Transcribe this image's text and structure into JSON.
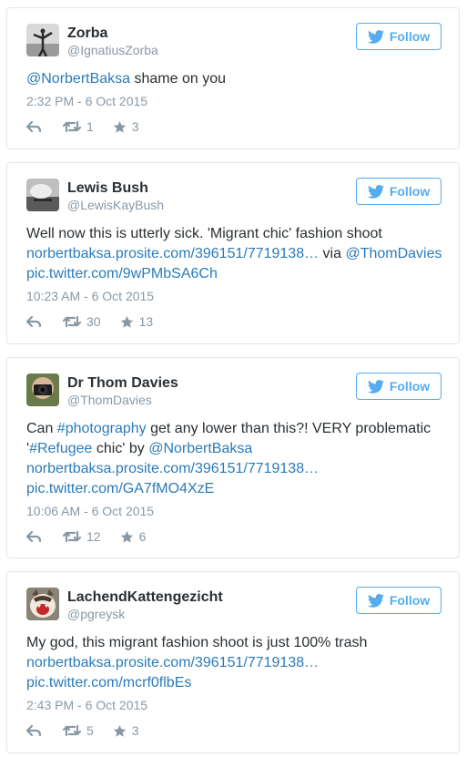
{
  "colors": {
    "link": "#2b7bb9",
    "follow": "#55acee",
    "muted": "#8899a6",
    "text": "#292f33",
    "border": "#e1e8ed"
  },
  "follow_label": "Follow",
  "tweets": [
    {
      "name": "Zorba",
      "handle": "@IgnatiusZorba",
      "avatar": "zorba-avatar-image",
      "mention": "@NorbertBaksa",
      "text_rest": " shame on you",
      "time": "2:32 PM - 6 Oct 2015",
      "retweets": "1",
      "favorites": "3"
    },
    {
      "name": "Lewis Bush",
      "handle": "@LewisKayBush",
      "avatar": "lewis-bush-avatar-image",
      "line1": "Well now this is utterly sick. 'Migrant chic' fashion shoot",
      "link1": "norbertbaksa.prosite.com/396151/7719138…",
      "via": " via ",
      "mention": "@ThomDavies",
      "link2": "pic.twitter.com/9wPMbSA6Ch",
      "time": "10:23 AM - 6 Oct 2015",
      "retweets": "30",
      "favorites": "13"
    },
    {
      "name": "Dr Thom Davies",
      "handle": "@ThomDavies",
      "avatar": "thom-davies-avatar-image",
      "pre": "Can ",
      "hashtag1": "#photography",
      "mid": " get any lower than this?! VERY problematic",
      "q1": "'",
      "hashtag2": "#Refugee",
      "mid2": " chic' by ",
      "mention": "@NorbertBaksa",
      "link1": "norbertbaksa.prosite.com/396151/7719138…",
      "link2": "pic.twitter.com/GA7fMO4XzE",
      "time": "10:06 AM - 6 Oct 2015",
      "retweets": "12",
      "favorites": "6"
    },
    {
      "name": "LachendKattengezicht",
      "handle": "@pgreysk",
      "avatar": "cat-avatar-image",
      "line1": "My god, this migrant fashion shoot is just 100% trash",
      "link1": "norbertbaksa.prosite.com/396151/7719138…",
      "link2": "pic.twitter.com/mcrf0flbEs",
      "time": "2:43 PM - 6 Oct 2015",
      "retweets": "5",
      "favorites": "3"
    }
  ]
}
